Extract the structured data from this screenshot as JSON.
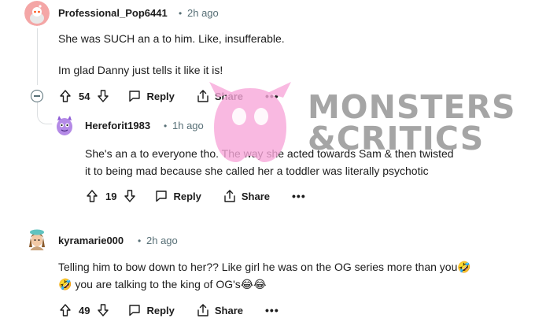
{
  "comments": [
    {
      "username": "Professional_Pop6441",
      "separator": "•",
      "timestamp": "2h ago",
      "lines": [
        "She was SUCH an a     to him.  Like, insufferable.",
        "Im glad Danny just tells it like it is!"
      ],
      "votes": "54",
      "reply_label": "Reply",
      "share_label": "Share",
      "more_label": "•••"
    },
    {
      "username": "Hereforit1983",
      "separator": "•",
      "timestamp": "1h ago",
      "lines": [
        "She's an a     to everyone tho. The way she acted towards Sam & then twisted",
        "it to being mad because she called her a toddler was literally psychotic"
      ],
      "votes": "19",
      "reply_label": "Reply",
      "share_label": "Share",
      "more_label": "•••"
    },
    {
      "username": "kyramarie000",
      "separator": "•",
      "timestamp": "2h ago",
      "lines": [
        "Telling him to bow down to her?? Like girl he was on the OG series more than you🤣",
        "🤣 you are talking to the king of OG's😂😂"
      ],
      "votes": "49",
      "reply_label": "Reply",
      "share_label": "Share",
      "more_label": "•••"
    }
  ],
  "watermark": {
    "line1": "MONSTERS",
    "line2": "&CRITICS"
  },
  "colors": {
    "text": "#1c1c1c",
    "meta": "#576f76",
    "thread": "#dcdfe1",
    "watermark_pink": "#f7a8d9"
  }
}
